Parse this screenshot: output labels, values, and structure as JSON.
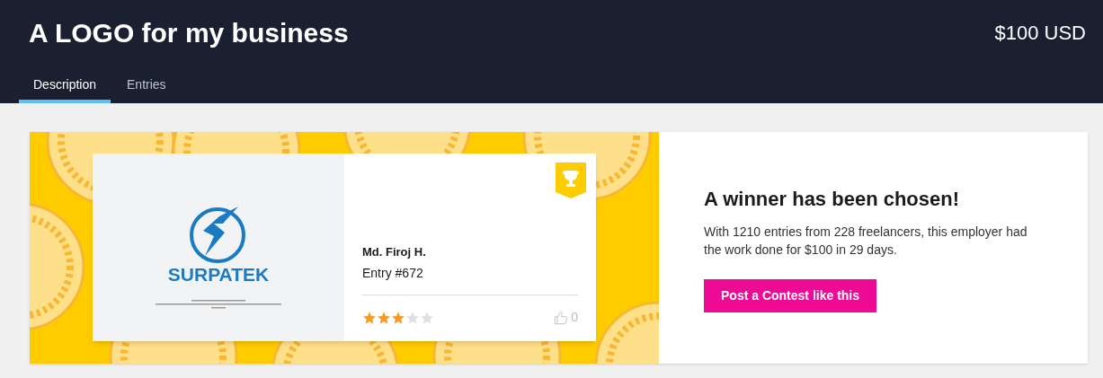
{
  "header": {
    "title": "A LOGO for my business",
    "price": "$100 USD"
  },
  "tabs": [
    {
      "label": "Description",
      "selected": true
    },
    {
      "label": "Entries",
      "selected": false
    }
  ],
  "entry": {
    "logo_text": "SURPATEK",
    "winner": true,
    "freelancer": "Md. Firoj H.",
    "entry_number": "Entry #672",
    "stars": 3,
    "likes": "0"
  },
  "result": {
    "heading": "A winner has been chosen!",
    "text": "With 1210 entries from 228 freelancers, this employer had the work done for $100 in 29 days.",
    "button": "Post a Contest like this"
  }
}
